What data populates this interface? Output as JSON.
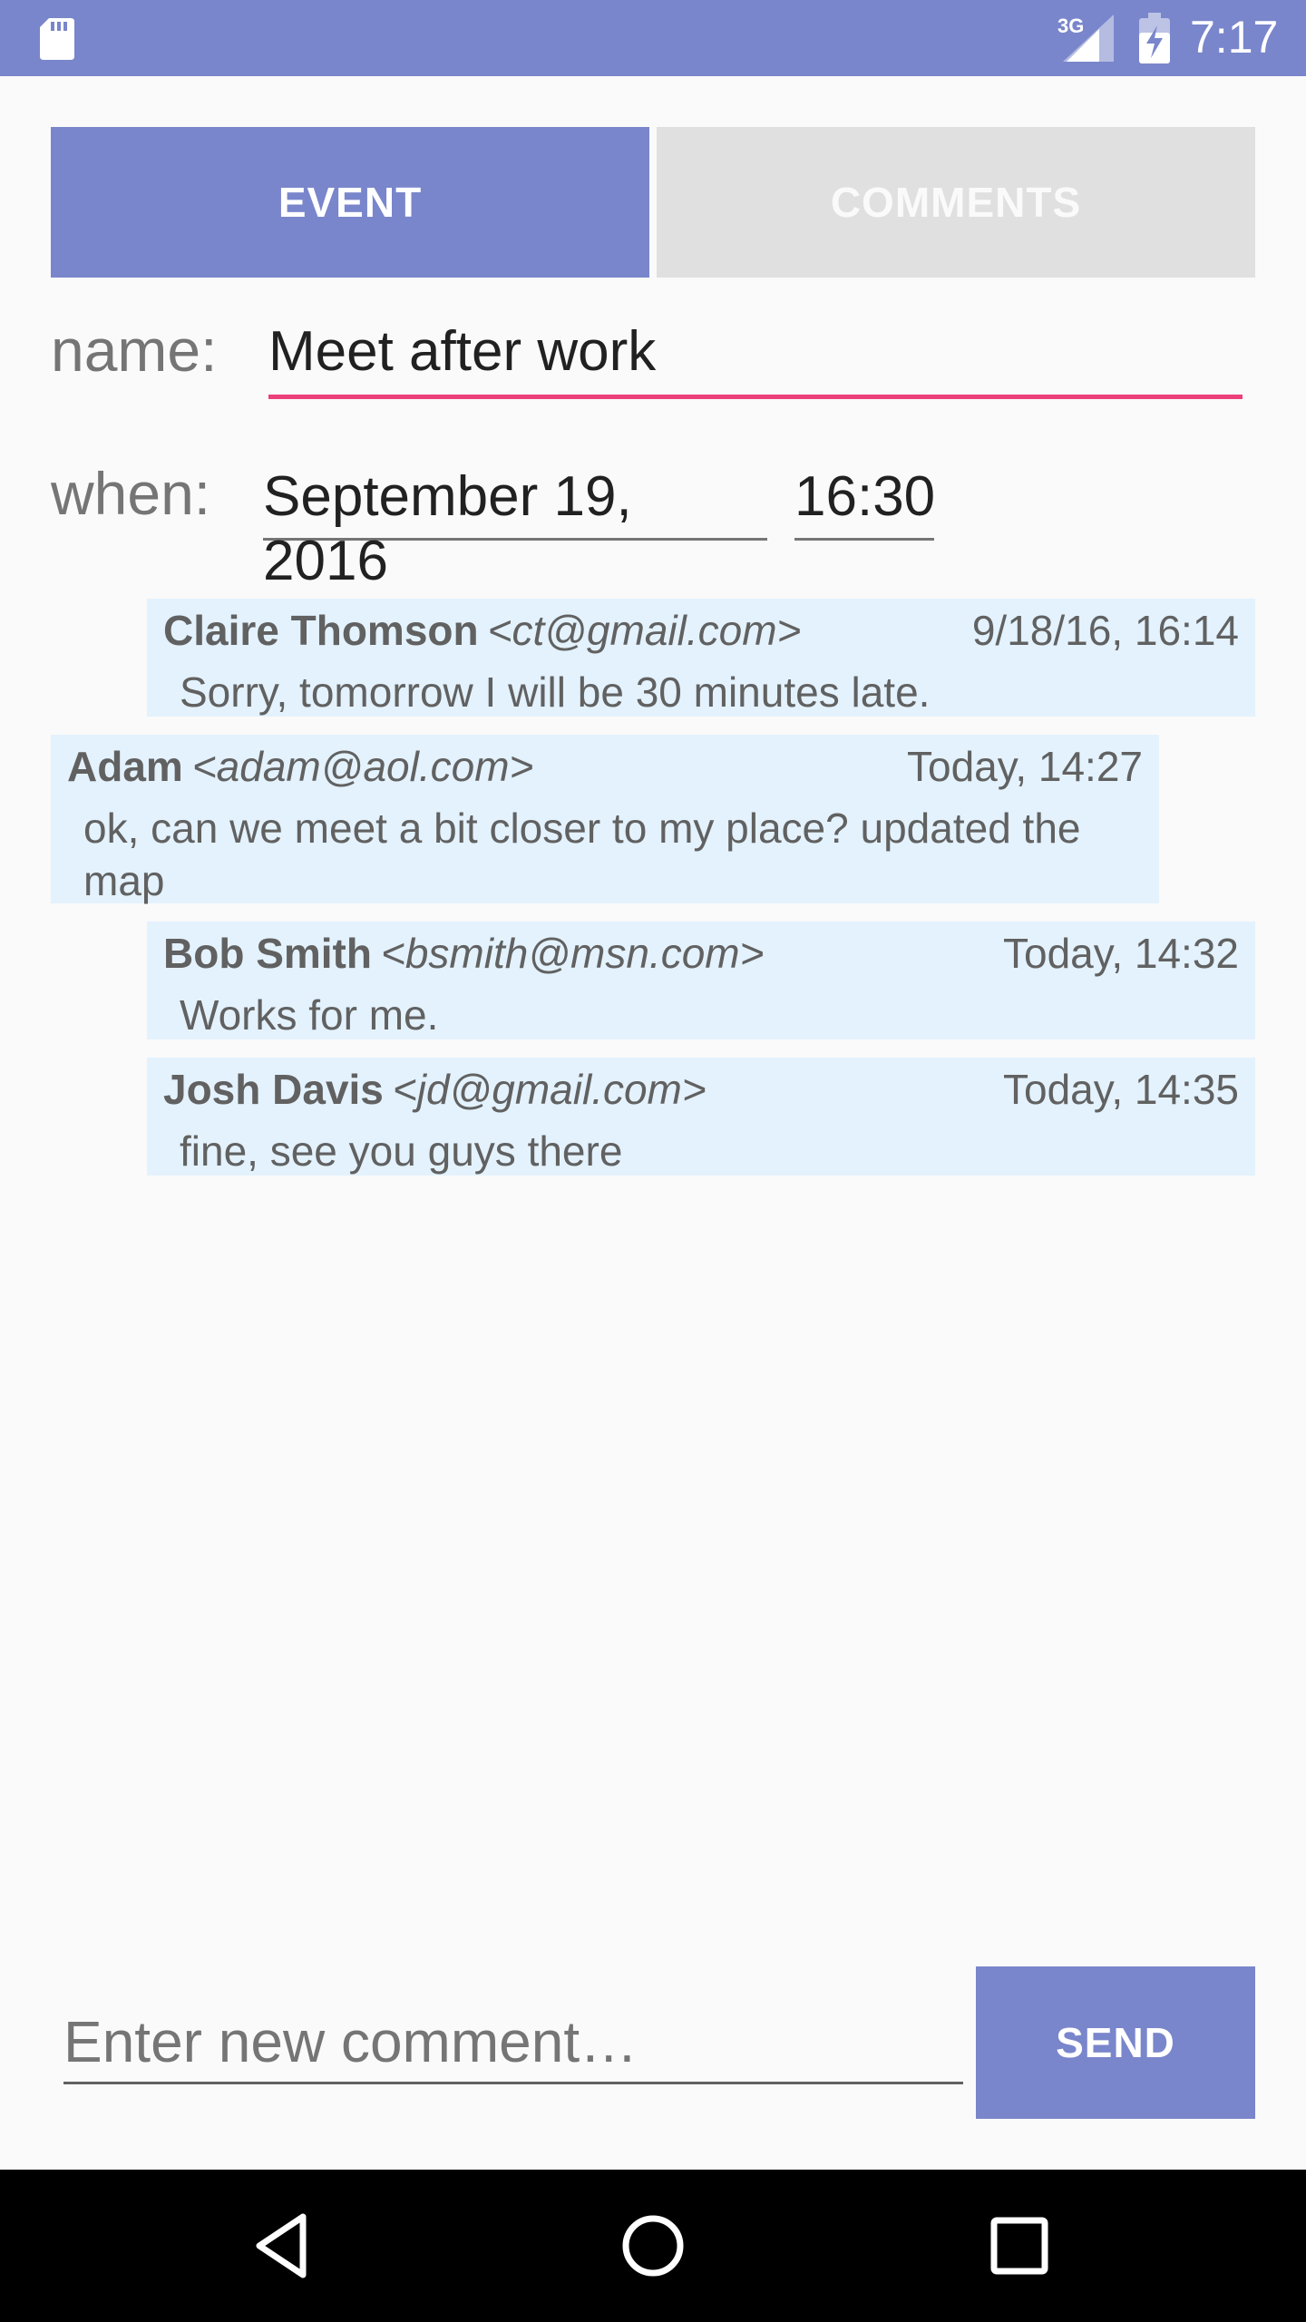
{
  "status_bar": {
    "network": "3G",
    "time": "7:17",
    "icons": [
      "sd-card-icon",
      "signal-icon",
      "battery-charging-icon"
    ]
  },
  "tabs": [
    {
      "label": "EVENT",
      "active": true
    },
    {
      "label": "COMMENTS",
      "active": false
    }
  ],
  "form": {
    "name_label": "name:",
    "name_value": "Meet after work",
    "when_label": "when:",
    "date_value": "September 19, 2016",
    "time_value": "16:30"
  },
  "comments": [
    {
      "author": "Claire Thomson",
      "email": "<ct@gmail.com>",
      "time": "9/18/16, 16:14",
      "text": "Sorry, tomorrow I will be 30 minutes late."
    },
    {
      "author": "Adam",
      "email": "<adam@aol.com>",
      "time": "Today, 14:27",
      "text": "ok, can we meet a bit closer to my place? updated the map"
    },
    {
      "author": "Bob Smith",
      "email": "<bsmith@msn.com>",
      "time": "Today, 14:32",
      "text": "Works for me."
    },
    {
      "author": "Josh Davis",
      "email": "<jd@gmail.com>",
      "time": "Today, 14:35",
      "text": "fine, see you guys there"
    }
  ],
  "composer": {
    "placeholder": "Enter new comment…",
    "send_label": "SEND"
  },
  "colors": {
    "primary": "#7986cb",
    "accent": "#ec407a",
    "comment_bg": "#e3f2fd",
    "tab_inactive": "#e0e0e0"
  }
}
